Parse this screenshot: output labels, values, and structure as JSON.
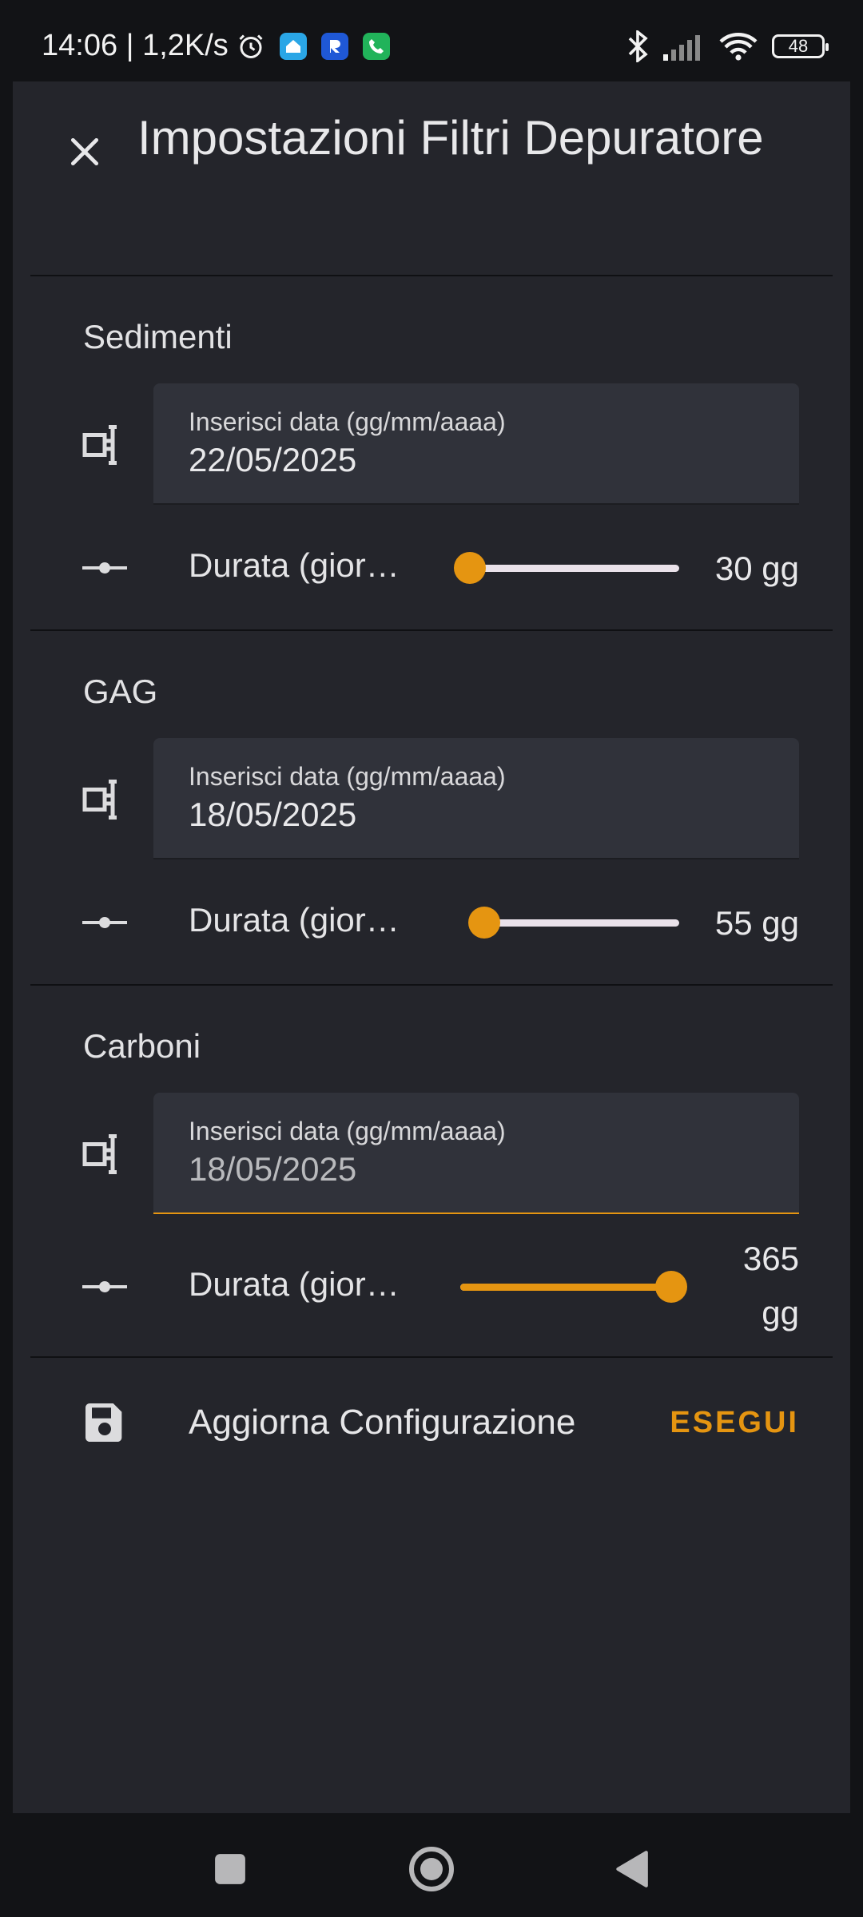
{
  "status_bar": {
    "time_speed": "14:06 | 1,2K/s",
    "battery": "48",
    "icons": [
      "alarm-icon",
      "home-app-icon",
      "r-app-icon",
      "phone-app-icon",
      "bluetooth-icon",
      "signal-icon",
      "wifi-icon",
      "battery-icon"
    ]
  },
  "dialog": {
    "title": "Impostazioni Filtri Depuratore",
    "accent_color": "#e59511",
    "sections": [
      {
        "name": "Sedimenti",
        "date_label": "Inserisci data (gg/mm/aaaa)",
        "date_value": "22/05/2025",
        "duration_label": "Durata (gior…",
        "duration_value": "30 gg",
        "slider_fraction": 0.0
      },
      {
        "name": "GAG",
        "date_label": "Inserisci data (gg/mm/aaaa)",
        "date_value": "18/05/2025",
        "duration_label": "Durata (gior…",
        "duration_value": "55 gg",
        "slider_fraction": 0.07
      },
      {
        "name": "Carboni",
        "date_label": "Inserisci data (gg/mm/aaaa)",
        "date_value": "18/05/2025",
        "duration_label": "Durata (gior…",
        "duration_value_line1": "365",
        "duration_value_line2": "gg",
        "slider_fraction": 1.0
      }
    ],
    "action": {
      "label": "Aggiorna Configurazione",
      "button": "ESEGUI"
    }
  },
  "navigation": {
    "icons": [
      "recents-square-icon",
      "home-circle-icon",
      "back-triangle-icon"
    ]
  }
}
